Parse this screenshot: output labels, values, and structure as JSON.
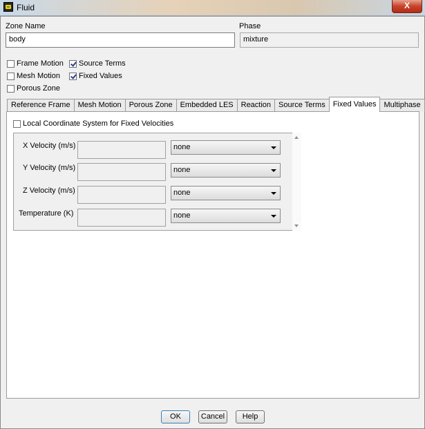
{
  "window": {
    "title": "Fluid",
    "close_glyph": "X"
  },
  "zone": {
    "label": "Zone Name",
    "value": "body"
  },
  "phase": {
    "label": "Phase",
    "value": "mixture"
  },
  "options": {
    "frame_motion": {
      "label": "Frame Motion",
      "checked": false
    },
    "mesh_motion": {
      "label": "Mesh Motion",
      "checked": false
    },
    "porous_zone": {
      "label": "Porous Zone",
      "checked": false
    },
    "source_terms": {
      "label": "Source Terms",
      "checked": true
    },
    "fixed_values": {
      "label": "Fixed Values",
      "checked": true
    }
  },
  "tabs": [
    {
      "label": "Reference Frame"
    },
    {
      "label": "Mesh Motion"
    },
    {
      "label": "Porous Zone"
    },
    {
      "label": "Embedded LES"
    },
    {
      "label": "Reaction"
    },
    {
      "label": "Source Terms"
    },
    {
      "label": "Fixed Values",
      "active": true
    },
    {
      "label": "Multiphase"
    }
  ],
  "fixed_values": {
    "local_coord_label": "Local Coordinate System for Fixed Velocities",
    "local_coord_checked": false,
    "rows": [
      {
        "label": "X Velocity (m/s)",
        "value": "",
        "option": "none"
      },
      {
        "label": "Y Velocity (m/s)",
        "value": "",
        "option": "none"
      },
      {
        "label": "Z Velocity (m/s)",
        "value": "",
        "option": "none"
      },
      {
        "label": "Temperature (K)",
        "value": "",
        "option": "none"
      }
    ]
  },
  "buttons": {
    "ok": "OK",
    "cancel": "Cancel",
    "help": "Help"
  },
  "colors": {
    "checkmark": "#2c3f8f",
    "close_button": "#c7432b"
  }
}
